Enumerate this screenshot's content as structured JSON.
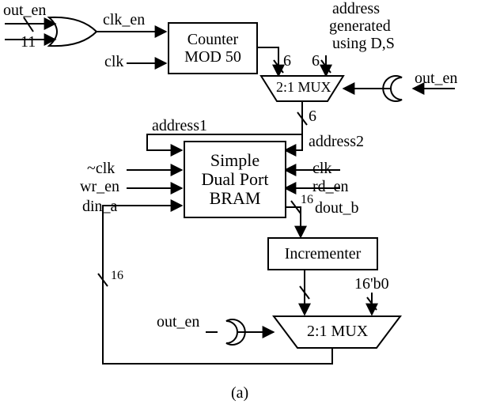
{
  "top": {
    "out_en": "out_en",
    "eleven": "11",
    "clk_en": "clk_en",
    "clk": "clk",
    "counter_l1": "Counter",
    "counter_l2": "MOD 50",
    "six_left": "6",
    "six_right": "6",
    "addr_l1": "address",
    "addr_l2": "generated",
    "addr_l3": "using D,S",
    "mux1": "2:1 MUX",
    "out_en_right": "out_en",
    "six_below": "6"
  },
  "mid": {
    "address1": "address1",
    "address2": "address2",
    "not_clk": "~clk",
    "clk": "clk",
    "wr_en": "wr_en",
    "rd_en": "rd_en",
    "din_a": "din_a",
    "bram_l1": "Simple",
    "bram_l2": "Dual Port",
    "bram_l3": "BRAM",
    "sixteen": "16",
    "dout_b": "dout_b"
  },
  "low": {
    "incrementer": "Incrementer",
    "zero16": "16'b0",
    "out_en": "out_en",
    "mux2": "2:1 MUX",
    "sixteen": "16"
  },
  "caption": "(a)"
}
